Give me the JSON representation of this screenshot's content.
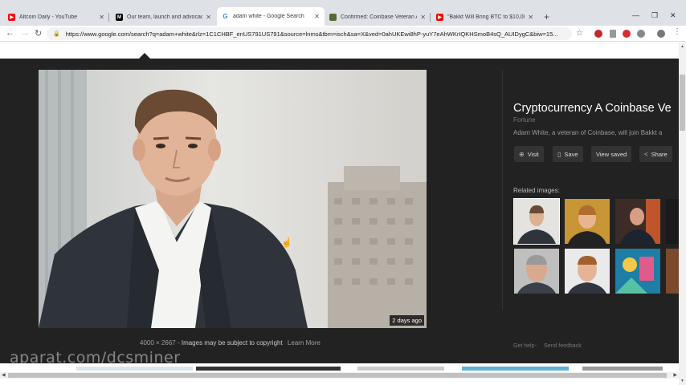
{
  "browser": {
    "tabs": [
      {
        "title": "Altcoin Daily - YouTube",
        "favicon": "youtube-icon",
        "color": "#ff0000"
      },
      {
        "title": "Our team, launch and advocacy",
        "favicon": "medium-icon",
        "color": "#000000"
      },
      {
        "title": "adam white - Google Search",
        "favicon": "google-icon",
        "color": "#4285f4"
      },
      {
        "title": "Confirmed: Coinbase Veteran Ad",
        "favicon": "news-icon",
        "color": "#556b2f"
      },
      {
        "title": "\"Bakkt Will Bring BTC to $10,000\"",
        "favicon": "youtube-icon",
        "color": "#ff0000"
      }
    ],
    "url": "https://www.google.com/search?q=adam+white&rlz=1C1CHBF_enUS791US791&source=lnms&tbm=isch&sa=X&ved=0ahUKEwi8hP-yuY7eAhWKrIQKHSmoB4sQ_AUIDygC&biw=15..."
  },
  "viewer": {
    "badge": "2 days ago",
    "dimensions": "4000 × 2667",
    "copyright": "Images may be subject to copyright",
    "learn_more": "Learn More",
    "title": "Cryptocurrency A Coinbase Ve",
    "source": "Fortune",
    "description": "Adam White, a veteran of Coinbase, will join Bakkt a",
    "buttons": {
      "visit": "Visit",
      "save": "Save",
      "view_saved": "View saved",
      "share": "Share"
    },
    "related_heading": "Related images:",
    "get_help": "Get help",
    "send_feedback": "Send feedback"
  },
  "watermark": "aparat.com/dcsminer",
  "colors": {
    "panel_bg": "#222222",
    "tab_strip": "#dee1e6"
  }
}
